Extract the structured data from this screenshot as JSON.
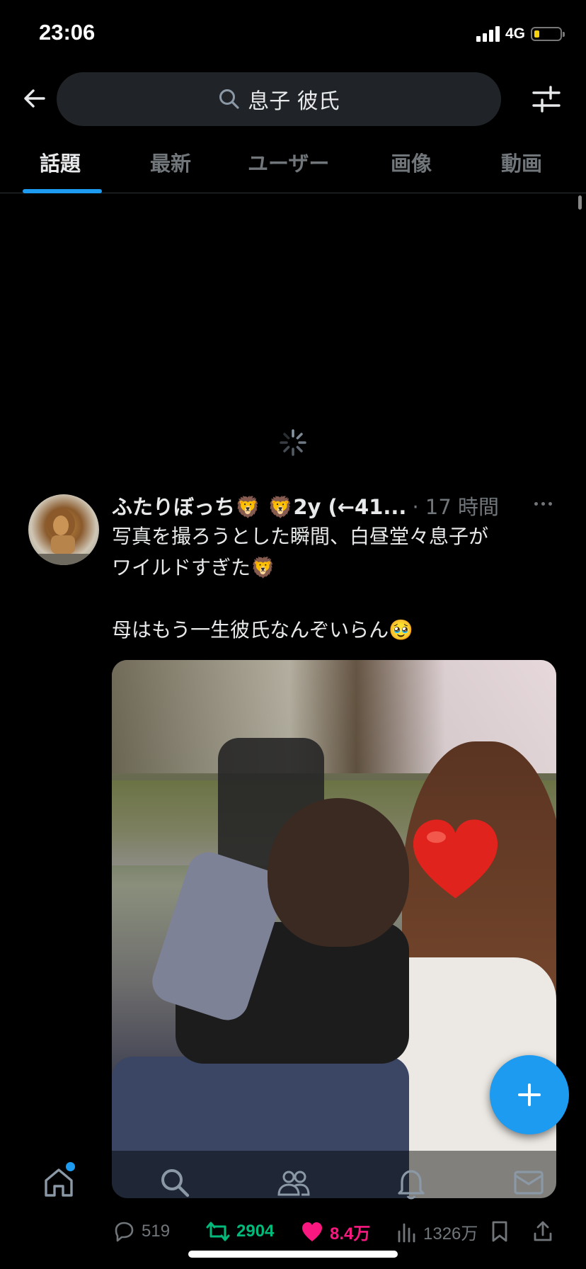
{
  "status_bar": {
    "time": "23:06",
    "network": "4G",
    "battery_level": 0.2
  },
  "search": {
    "query": "息子 彼氏"
  },
  "tabs": [
    {
      "label": "話題",
      "active": true
    },
    {
      "label": "最新",
      "active": false
    },
    {
      "label": "ユーザー",
      "active": false
    },
    {
      "label": "画像",
      "active": false
    },
    {
      "label": "動画",
      "active": false
    }
  ],
  "tweet": {
    "display_name": "ふたりぼっち🦁 🦁2y (←41...",
    "time": "· 17 時間",
    "text": "写真を撮ろうとした瞬間、白昼堂々息子が\nワイルドすぎた🦁\n\n母はもう一生彼氏なんぞいらん🥹",
    "replies": "519",
    "retweets": "2904",
    "likes": "8.4万",
    "views": "1326万"
  },
  "colors": {
    "accent": "#1d9bf0",
    "retweet_green": "#00ba7c",
    "like_pink": "#f91880",
    "muted": "#71767b",
    "battery": "#f5d10b"
  },
  "icons": {
    "back": "back-arrow-icon",
    "search": "search-icon",
    "filter": "filter-icon",
    "reply": "reply-icon",
    "retweet": "retweet-icon",
    "like": "heart-icon",
    "views": "views-icon",
    "bookmark": "bookmark-icon",
    "share": "share-icon",
    "home": "home-icon",
    "explore": "search-icon",
    "communities": "communities-icon",
    "notifications": "bell-icon",
    "messages": "mail-icon",
    "compose": "plus-icon"
  }
}
